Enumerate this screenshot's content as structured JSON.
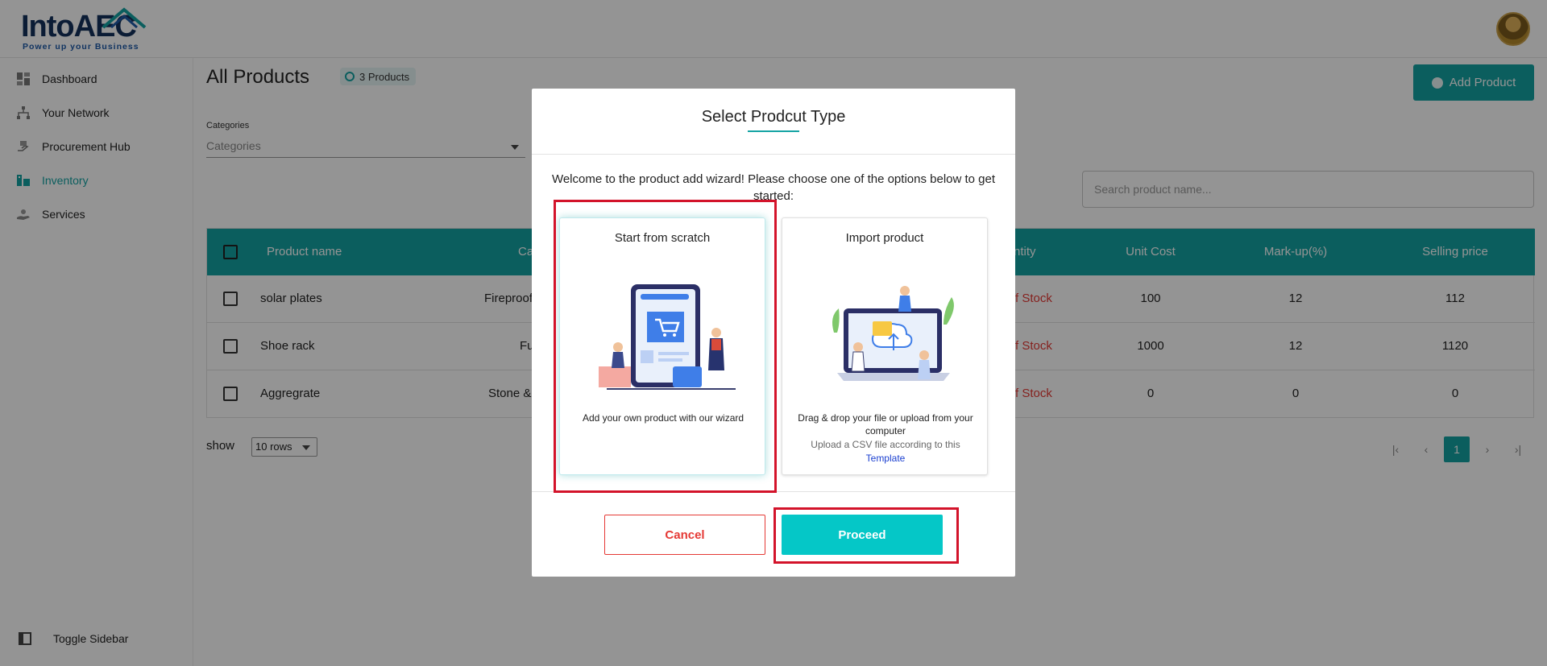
{
  "app": {
    "logo_main": "Into",
    "logo_accent": "AEC",
    "logo_tagline": "Power up your Business"
  },
  "sidebar": {
    "items": [
      {
        "label": "Dashboard",
        "icon": "dashboard-icon"
      },
      {
        "label": "Your Network",
        "icon": "network-icon"
      },
      {
        "label": "Procurement Hub",
        "icon": "procurement-icon"
      },
      {
        "label": "Inventory",
        "icon": "inventory-icon",
        "active": true
      },
      {
        "label": "Services",
        "icon": "services-icon"
      }
    ],
    "toggle_label": "Toggle Sidebar"
  },
  "main": {
    "title": "All Products",
    "count_badge": "3 Products",
    "add_button": "Add Product",
    "categories_label": "Categories",
    "categories_placeholder": "Categories",
    "search_placeholder": "Search product name..."
  },
  "table": {
    "headers": [
      "Product name",
      "Ca",
      "ntity",
      "Unit Cost",
      "Mark-up(%)",
      "Selling price"
    ],
    "rows": [
      {
        "name": "solar plates",
        "category": "Fireproof",
        "stock": "f Stock",
        "unit_cost": "100",
        "markup": "12",
        "selling_price": "112"
      },
      {
        "name": "Shoe rack",
        "category": "Fu",
        "stock": "f Stock",
        "unit_cost": "1000",
        "markup": "12",
        "selling_price": "1120"
      },
      {
        "name": "Aggregrate",
        "category": "Stone &",
        "stock": "f Stock",
        "unit_cost": "0",
        "markup": "0",
        "selling_price": "0"
      }
    ]
  },
  "pagination": {
    "show_label": "show",
    "rows_value": "10 rows",
    "first": "|‹",
    "prev": "‹",
    "current_page": "1",
    "next": "›",
    "last": "›|"
  },
  "modal": {
    "title": "Select Prodcut Type",
    "welcome": "Welcome to the product add wizard! Please choose one of the options below to get started:",
    "options": [
      {
        "title": "Start from scratch",
        "desc": "Add your own product with our wizard"
      },
      {
        "title": "Import product",
        "desc": "Drag & drop your file or upload from your computer",
        "sub": "Upload a CSV file according to this",
        "link": "Template"
      }
    ],
    "cancel_label": "Cancel",
    "proceed_label": "Proceed"
  },
  "colors": {
    "accent": "#14a3a3",
    "proceed": "#05c7c7",
    "danger": "#e53935",
    "highlight": "#d3132a"
  }
}
